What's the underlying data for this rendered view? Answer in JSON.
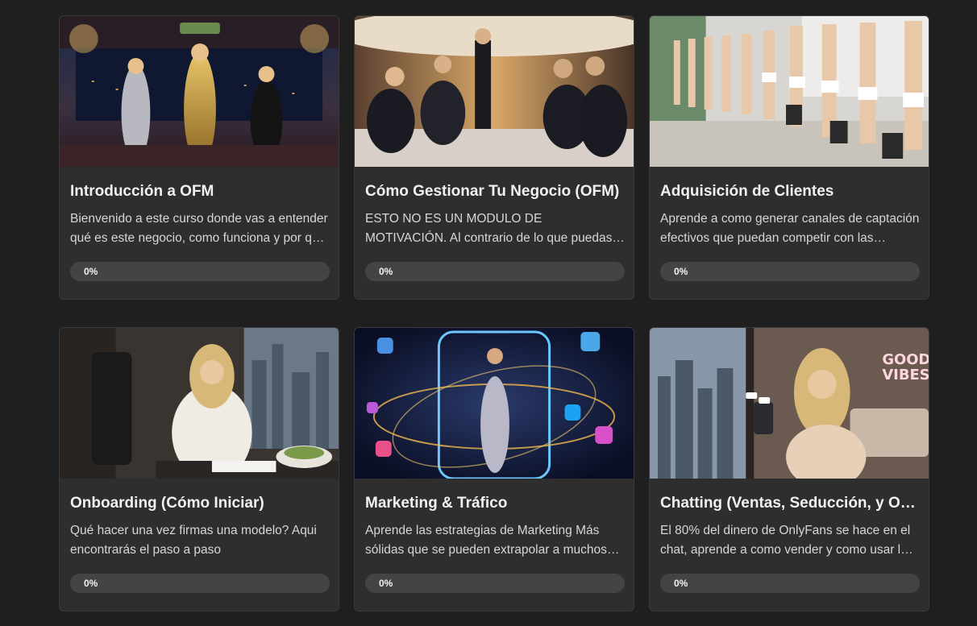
{
  "courses": [
    {
      "title": "Introducción a OFM",
      "description": "Bienvenido a este curso donde vas a entender qué es este negocio, como funciona y por qué puede cambiar tu vida.",
      "progress_label": "0%",
      "progress": 0,
      "image_name": "luxury-penthouse-models-image"
    },
    {
      "title": "Cómo Gestionar Tu Negocio (OFM)",
      "description": "ESTO NO ES UN MODULO DE MOTIVACIÓN. Al contrario de lo que puedas pensar, esto no es para todo el mundo.",
      "progress_label": "0%",
      "progress": 0,
      "image_name": "private-jet-meeting-image"
    },
    {
      "title": "Adquisición de Clientes",
      "description": "Aprende a como generar canales de captación efectivos que puedan competir con las mejores agencias.",
      "progress_label": "0%",
      "progress": 0,
      "image_name": "talent-agency-lobby-image"
    },
    {
      "title": "Onboarding (Cómo Iniciar)",
      "description": "Qué hacer una vez firmas una modelo? Aqui encontrarás el paso a paso",
      "progress_label": "0%",
      "progress": 0,
      "image_name": "signing-contract-image"
    },
    {
      "title": "Marketing & Tráfico",
      "description": "Aprende las estrategias de Marketing Más sólidas que se pueden extrapolar a muchos negocios.",
      "progress_label": "0%",
      "progress": 0,
      "image_name": "social-media-phone-image"
    },
    {
      "title": "Chatting (Ventas, Seducción, y Onboarding)",
      "description": "El 80% del dinero de OnlyFans se hace en el chat, aprende a como vender y como usar la psicología.",
      "progress_label": "0%",
      "progress": 0,
      "image_name": "chatting-phone-image",
      "neon_sign": [
        "GOOD",
        "VIBES"
      ]
    }
  ],
  "colors": {
    "background": "#1f1f1f",
    "card": "#2e2e2e",
    "progress_track": "#444444"
  }
}
